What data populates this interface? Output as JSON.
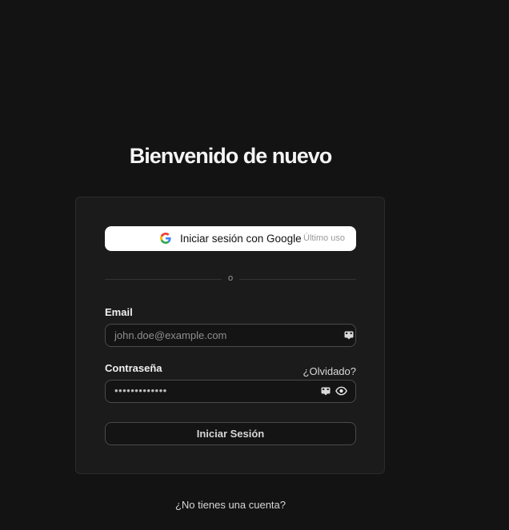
{
  "page": {
    "title": "Bienvenido de nuevo"
  },
  "login_card": {
    "google_button_label": "Iniciar sesión con Google",
    "google_last_used": "Último uso",
    "divider_text": "o",
    "email": {
      "label": "Email",
      "placeholder": "john.doe@example.com"
    },
    "password": {
      "label": "Contraseña",
      "forgot_link": "¿Olvidado?",
      "masked_value": "•••••••••••••"
    },
    "submit_label": "Iniciar Sesión"
  },
  "footer": {
    "signup_link": "¿No tienes una cuenta?"
  },
  "icons": {
    "google": "google-logo-icon",
    "autofill": "autofill-card-icon",
    "show_password": "eye-icon"
  },
  "colors": {
    "background": "#131313",
    "card_background": "#1b1b1b",
    "google_button": "#ffffff",
    "input_border": "#4a4a4a"
  }
}
